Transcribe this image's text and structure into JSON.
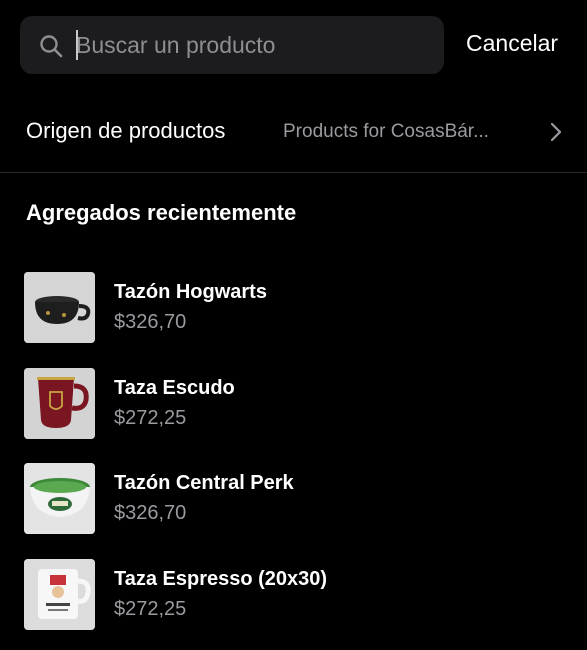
{
  "search": {
    "placeholder": "Buscar un producto",
    "value": "",
    "cancel_label": "Cancelar"
  },
  "origin": {
    "label": "Origen de productos",
    "value": "Products for CosasBár..."
  },
  "section": {
    "title": "Agregados recientemente"
  },
  "products": [
    {
      "name": "Tazón Hogwarts",
      "price": "$326,70",
      "image": "black-cauldron-mug"
    },
    {
      "name": "Taza Escudo",
      "price": "$272,25",
      "image": "red-crest-mug"
    },
    {
      "name": "Tazón Central Perk",
      "price": "$326,70",
      "image": "white-green-central-perk-mug"
    },
    {
      "name": "Taza Espresso (20x30)",
      "price": "$272,25",
      "image": "white-printed-mug"
    }
  ],
  "colors": {
    "background": "#000000",
    "search_field": "#1c1c1e",
    "secondary_text": "#9a9aa0",
    "divider": "#2c2c2e"
  }
}
